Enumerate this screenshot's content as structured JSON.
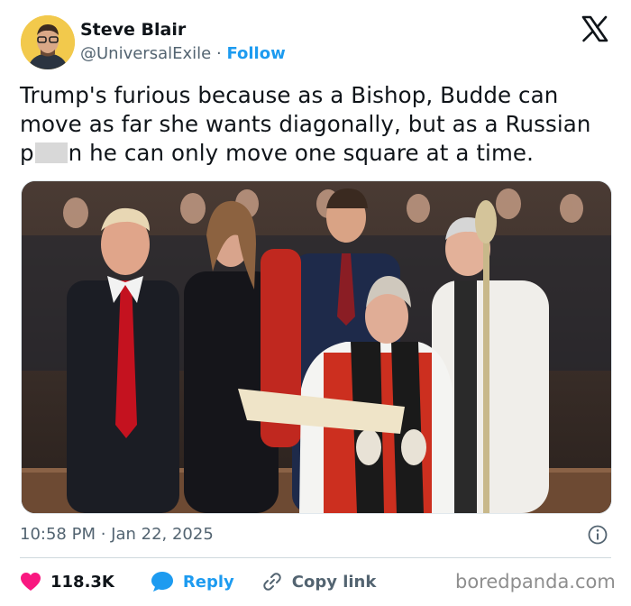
{
  "author": {
    "name": "Steve Blair",
    "handle": "@UniversalExile",
    "separator": "·",
    "follow_label": "Follow"
  },
  "header": {
    "logo_icon": "x-logo-icon"
  },
  "tweet": {
    "lines": [
      "Trump's furious because as a Bishop, Budde can",
      "move as far she wants diagonally, but as a Russian"
    ],
    "line3_start": "p",
    "line3_end": "n he can only move one square at a time."
  },
  "photo": {
    "description_icon": "photo"
  },
  "meta": {
    "timestamp": "10:58 PM · Jan 22, 2025",
    "info_icon": "info-icon"
  },
  "actions": {
    "likes": "118.3K",
    "reply_label": "Reply",
    "copy_label": "Copy link"
  },
  "colors": {
    "accent": "#1d9bf0",
    "like": "#f91880",
    "muted": "#536471"
  },
  "watermark": "boredpanda.com"
}
